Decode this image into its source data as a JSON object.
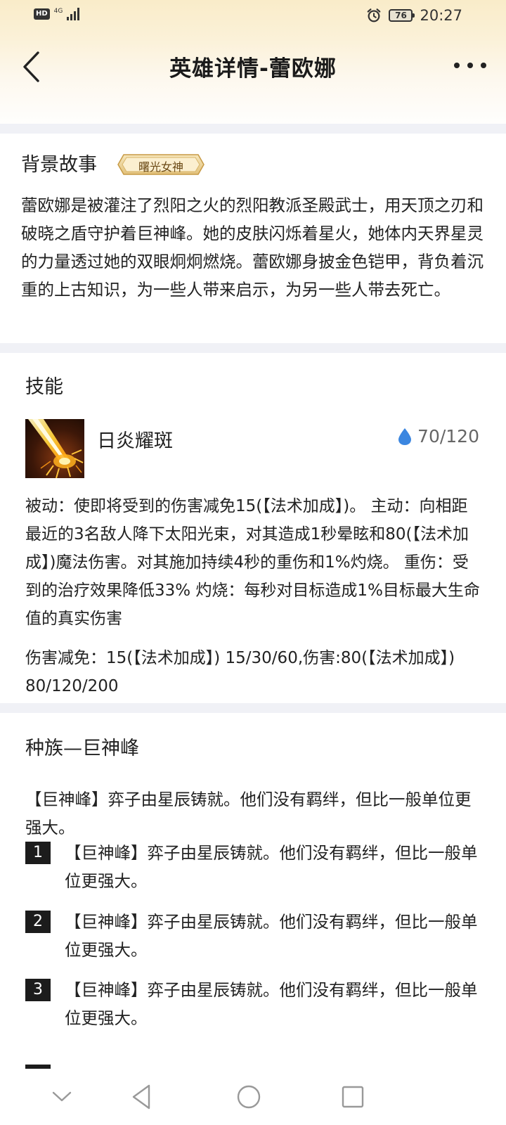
{
  "status_bar": {
    "hd": "HD",
    "network": "4G",
    "battery": "76",
    "time": "20:27"
  },
  "header": {
    "title": "英雄详情-蕾欧娜",
    "icons": {
      "back": "chevron-left-icon",
      "more": "more-horizontal-icon"
    }
  },
  "background_story": {
    "section_title": "背景故事",
    "badge": "曙光女神",
    "text": "蕾欧娜是被灌注了烈阳之火的烈阳教派圣殿武士，用天顶之刃和破晓之盾守护着巨神峰。她的皮肤闪烁着星火，她体内天界星灵的力量透过她的双眼炯炯燃烧。蕾欧娜身披金色铠甲，背负着沉重的上古知识，为一些人带来启示，为另一些人带去死亡。"
  },
  "skills": {
    "section_title": "技能",
    "skill": {
      "name": "日炎耀斑",
      "mana": "70/120",
      "mana_icon": "water-drop-icon",
      "description": "被动：使即将受到的伤害减免15(【法术加成】)。 主动：向相距最近的3名敌人降下太阳光束，对其造成1秒晕眩和80(【法术加成】)魔法伤害。对其施加持续4秒的重伤和1%灼烧。 重伤：受到的治疗效果降低33% 灼烧：每秒对目标造成1%目标最大生命值的真实伤害",
      "values": "伤害减免：15(【法术加成】) 15/30/60,伤害:80(【法术加成】) 80/120/200"
    }
  },
  "race": {
    "section_title": "种族—巨神峰",
    "intro": "【巨神峰】弈子由星辰铸就。他们没有羁绊，但比一般单位更强大。",
    "bonuses": [
      {
        "num": "1",
        "text": "【巨神峰】弈子由星辰铸就。他们没有羁绊，但比一般单位更强大。"
      },
      {
        "num": "2",
        "text": "【巨神峰】弈子由星辰铸就。他们没有羁绊，但比一般单位更强大。"
      },
      {
        "num": "3",
        "text": "【巨神峰】弈子由星辰铸就。他们没有羁绊，但比一般单位更强大。"
      }
    ]
  },
  "system_nav": {
    "icons": [
      "chevron-down-icon",
      "back-triangle-icon",
      "home-circle-icon",
      "recents-square-icon"
    ]
  },
  "colors": {
    "header_gradient": "#f9ecc9",
    "divider": "#f0f1f6",
    "badge_gold": "#e9cf94",
    "mana_blue": "#3b86e0",
    "number_box": "#1c1c1c"
  }
}
